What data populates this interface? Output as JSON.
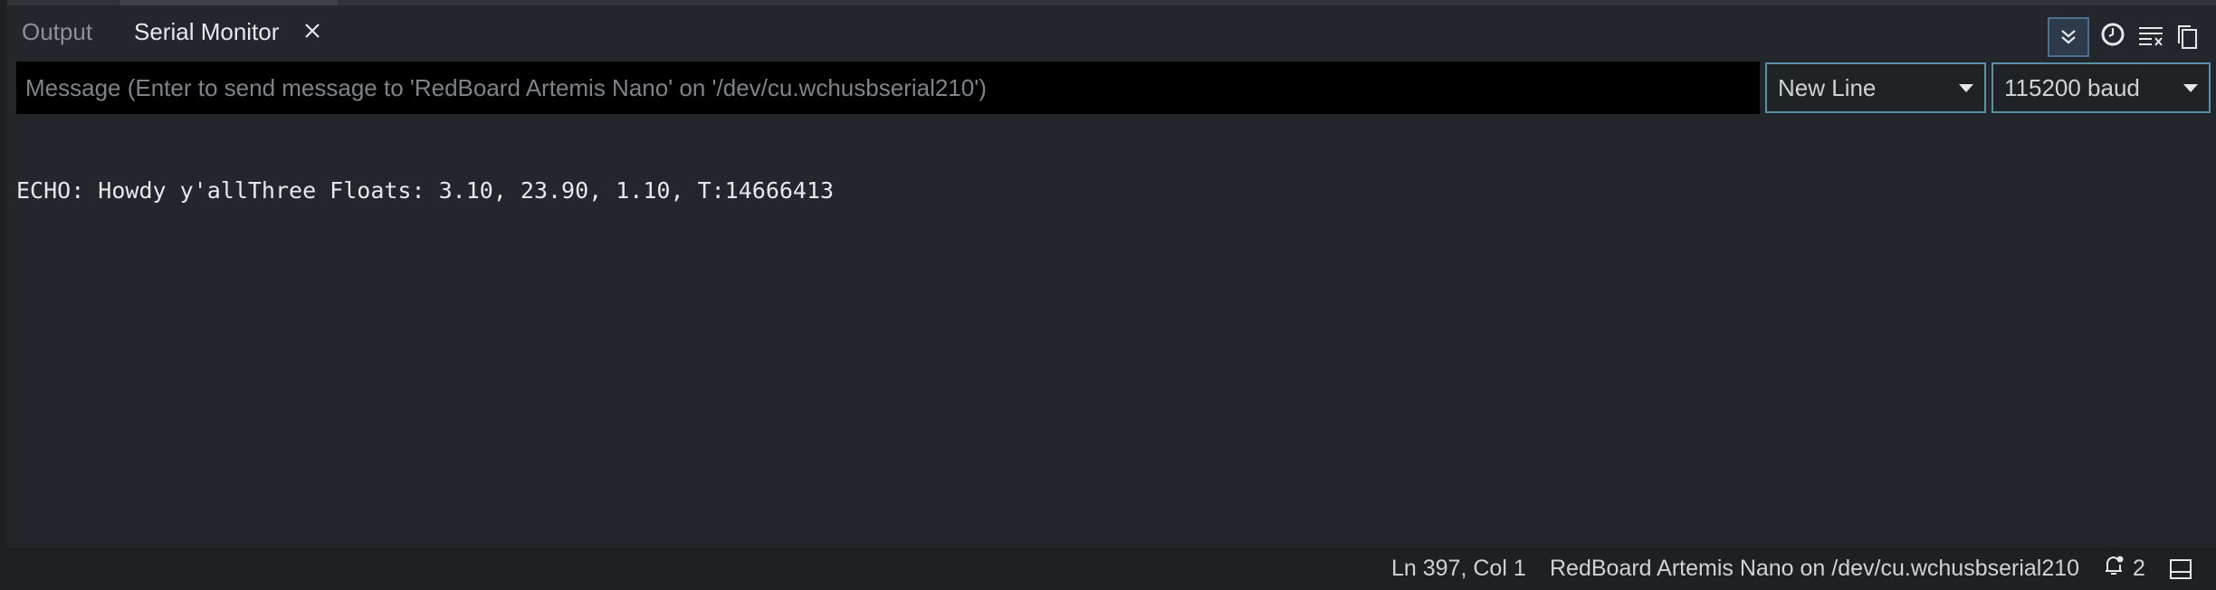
{
  "tabs": [
    {
      "label": "Output",
      "active": false
    },
    {
      "label": "Serial Monitor",
      "active": true
    }
  ],
  "toolbar": {
    "icons": [
      "autoscroll-icon",
      "timestamp-clock-icon",
      "clear-output-icon",
      "copy-output-icon"
    ]
  },
  "message": {
    "placeholder": "Message (Enter to send message to 'RedBoard Artemis Nano' on '/dev/cu.wchusbserial210')",
    "value": ""
  },
  "line_ending": {
    "selected": "New Line"
  },
  "baud_rate": {
    "selected": "115200 baud"
  },
  "output": {
    "lines": [
      "ECHO: Howdy y'allThree Floats: 3.10, 23.90, 1.10, T:14666413"
    ]
  },
  "status": {
    "cursor": "Ln 397, Col 1",
    "board": "RedBoard Artemis Nano on /dev/cu.wchusbserial210",
    "notification_count": "2"
  },
  "colors": {
    "background": "#23272b",
    "input_background": "#000000",
    "select_border": "#5c8fa8",
    "autoscroll_active": "#4c6f92"
  }
}
